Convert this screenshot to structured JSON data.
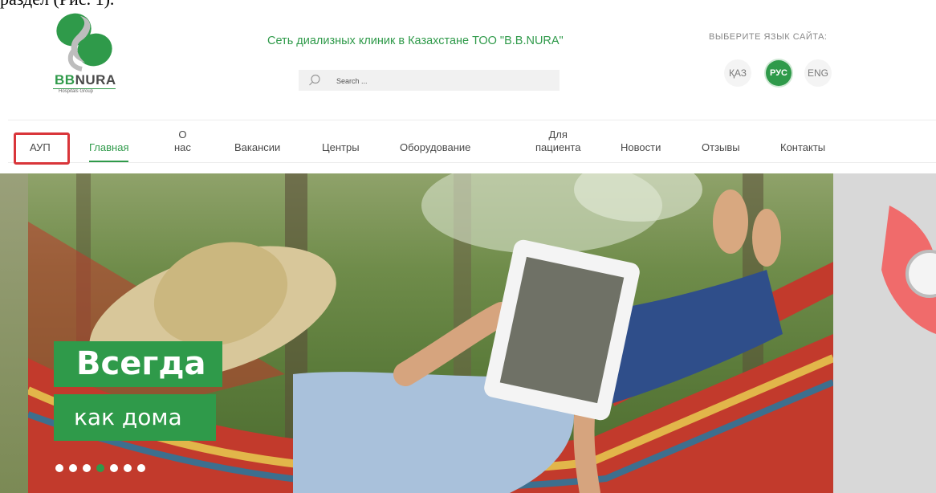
{
  "fragment_text": "раздел (Рис. 1).",
  "brand": {
    "name_bb": "BB",
    "name_nura": "NURA",
    "subtitle": "Hospitals Group",
    "accent": "#2f9a4a"
  },
  "header": {
    "site_title": "Сеть диализных клиник в Казахстане ТОО \"B.B.NURA\"",
    "search_placeholder": "Search ...",
    "language_label": "ВЫБЕРИТЕ ЯЗЫК САЙТА:",
    "languages": [
      {
        "code": "ҚАЗ",
        "active": false
      },
      {
        "code": "РУС",
        "active": true
      },
      {
        "code": "ENG",
        "active": false
      }
    ]
  },
  "nav": {
    "items": [
      {
        "label": "АУП",
        "highlighted": true
      },
      {
        "label": "Главная",
        "active": true
      },
      {
        "label": "О\nнас"
      },
      {
        "label": "Вакансии"
      },
      {
        "label": "Центры"
      },
      {
        "label": "Оборудование"
      },
      {
        "label": "Для\nпациента"
      },
      {
        "label": "Новости"
      },
      {
        "label": "Отзывы"
      },
      {
        "label": "Контакты"
      }
    ],
    "highlight_color": "#d9353a"
  },
  "hero": {
    "line1": "Всегда",
    "line2": "как дома",
    "slide_count": 7,
    "active_slide": 4
  }
}
